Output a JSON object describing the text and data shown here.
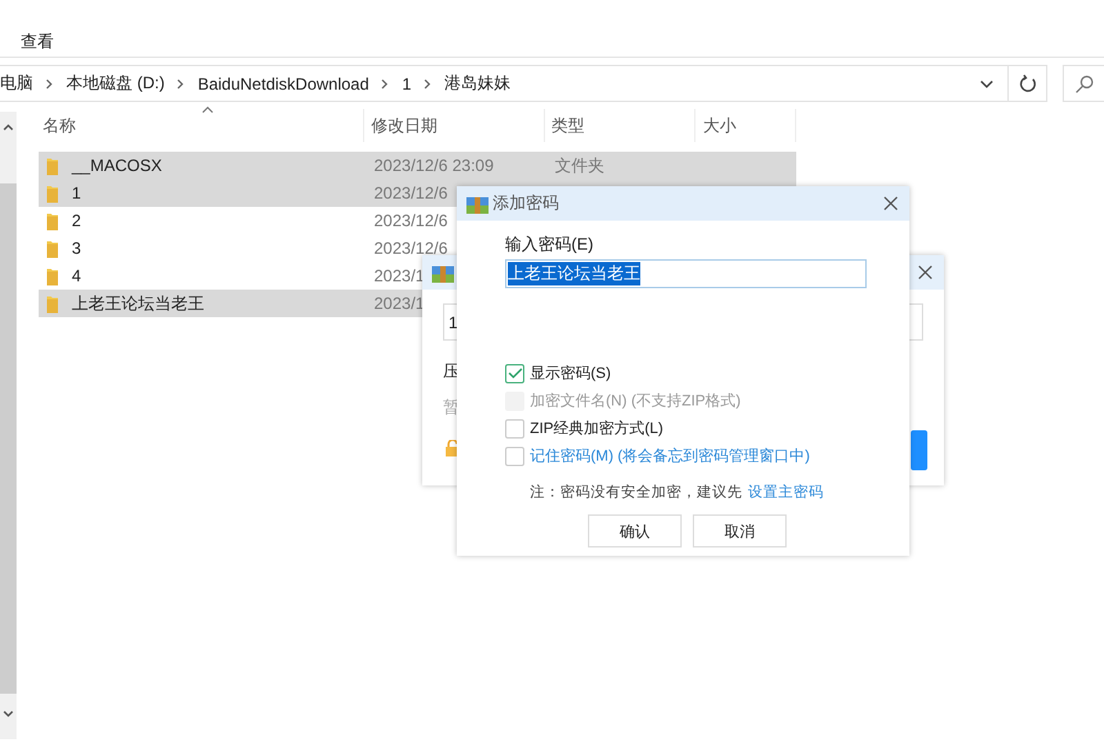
{
  "menu": [
    "查看"
  ],
  "breadcrumb": [
    "电脑",
    "本地磁盘 (D:)",
    "BaiduNetdiskDownload",
    "1",
    "港岛妹妹"
  ],
  "columns": [
    {
      "label": "名称",
      "sorted": true
    },
    {
      "label": "修改日期",
      "sorted": false
    },
    {
      "label": "类型",
      "sorted": false
    },
    {
      "label": "大小",
      "sorted": false
    }
  ],
  "rows": [
    {
      "name": "__MACOSX",
      "date": "2023/12/6 23:09",
      "type": "文件夹",
      "selected": true
    },
    {
      "name": "1",
      "date": "2023/12/6",
      "selected": true
    },
    {
      "name": "2",
      "date": "2023/12/6",
      "selected": false
    },
    {
      "name": "3",
      "date": "2023/12/6",
      "selected": false
    },
    {
      "name": "4",
      "date": "2023/1",
      "selected": false
    },
    {
      "name": "上老王论坛当老王",
      "date": "2023/1",
      "selected": true
    }
  ],
  "back_dialog": {
    "field_value": "1",
    "label": "压",
    "hint": "暂"
  },
  "dialog": {
    "title": "添加密码",
    "password_label": "输入密码(E)",
    "password": "上老王论坛当老王",
    "options": [
      {
        "kind": "plain",
        "label": "显示密码(S)",
        "checked": true,
        "disabled": false
      },
      {
        "kind": "plain",
        "label": "加密文件名(N) (不支持ZIP格式)",
        "checked": false,
        "disabled": true
      },
      {
        "kind": "plain",
        "label": "ZIP经典加密方式(L)",
        "checked": false,
        "disabled": false
      },
      {
        "kind": "link",
        "label": "记住密码(M) (将会备忘到密码管理窗口中)",
        "checked": false,
        "disabled": false
      }
    ],
    "note": "注：密码没有安全加密，建议先",
    "note_link": "设置主密码",
    "buttons": [
      "确认",
      "取消"
    ]
  }
}
